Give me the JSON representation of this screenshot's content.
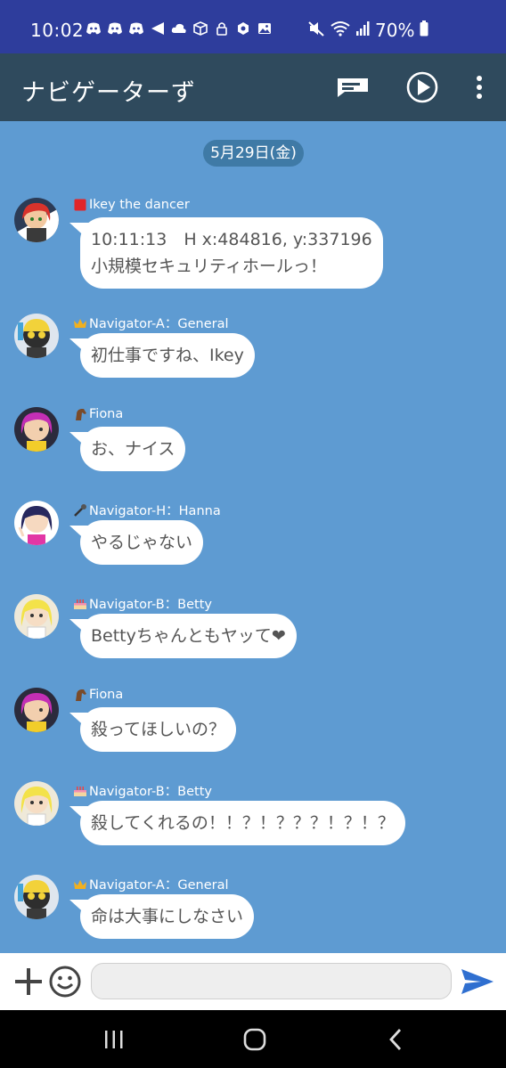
{
  "status_bar": {
    "time": "10:02",
    "battery": "70%",
    "left_icons": [
      "discord-icon",
      "discord-icon",
      "discord-icon",
      "share-icon",
      "cloud-icon",
      "box-icon",
      "lock-icon",
      "hexagon-icon",
      "image-icon"
    ],
    "right_icons": [
      "mute-icon",
      "wifi-icon",
      "signal-icon",
      "battery-icon"
    ]
  },
  "app_bar": {
    "title": "ナビゲーターず",
    "actions": [
      "message-icon",
      "play-icon",
      "more-vert-icon"
    ]
  },
  "chat": {
    "date": "5月29日(金)",
    "messages": [
      {
        "sender": "Ikey the dancer",
        "sender_icon": "red-square-icon",
        "text": "10:11:13　H x:484816, y:337196\n小規模セキュリティホールっ！"
      },
      {
        "sender": "Navigator-A：General",
        "sender_icon": "crown-icon",
        "text": "初仕事ですね、Ikey"
      },
      {
        "sender": "Fiona",
        "sender_icon": "horse-icon",
        "text": "お、ナイス"
      },
      {
        "sender": "Navigator-H：Hanna",
        "sender_icon": "microphone-icon",
        "text": "やるじゃない"
      },
      {
        "sender": "Navigator-B：Betty",
        "sender_icon": "cake-icon",
        "text": "Bettyちゃんともヤッて❤"
      },
      {
        "sender": "Fiona",
        "sender_icon": "horse-icon",
        "text": "殺ってほしいの？"
      },
      {
        "sender": "Navigator-B：Betty",
        "sender_icon": "cake-icon",
        "text": "殺してくれるの！！？！？？？！？！？"
      },
      {
        "sender": "Navigator-A：General",
        "sender_icon": "crown-icon",
        "text": "命は大事にしなさい"
      }
    ]
  },
  "input_bar": {
    "value": "",
    "placeholder": ""
  },
  "colors": {
    "status_bar": "#2e3d9c",
    "app_bar": "#2f4a5d",
    "chat_background": "#5e9bd2",
    "date_chip": "#3f7aa6",
    "send_button": "#2f6fd0"
  }
}
